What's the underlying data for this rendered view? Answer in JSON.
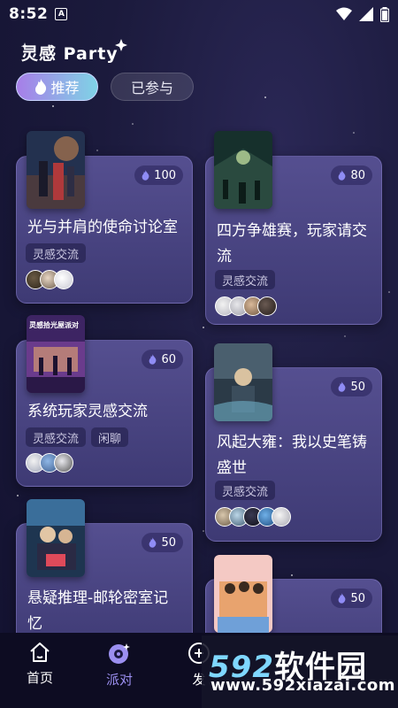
{
  "status_bar": {
    "time": "8:52"
  },
  "header": {
    "title": "灵感 Party"
  },
  "tabs": [
    {
      "label": "推荐",
      "active": true
    },
    {
      "label": "已参与",
      "active": false
    }
  ],
  "cards": [
    {
      "title_lines": [
        "光与并肩的使命讨论室"
      ],
      "heat": "100",
      "tags": [
        "灵感交流"
      ]
    },
    {
      "title_lines": [
        "四方争雄赛，玩家请交",
        "流"
      ],
      "heat": "80",
      "tags": [
        "灵感交流"
      ]
    },
    {
      "title_lines": [
        "系统玩家灵感交流"
      ],
      "heat": "60",
      "tags": [
        "灵感交流",
        "闲聊"
      ],
      "cover_text": "灵感拾光屋派对"
    },
    {
      "title_lines": [
        "风起大雍：我以史笔铸",
        "盛世"
      ],
      "heat": "50",
      "tags": [
        "灵感交流"
      ]
    },
    {
      "title_lines": [
        "悬疑推理-邮轮密室记",
        "忆"
      ],
      "heat": "50",
      "tags": []
    },
    {
      "title_lines": [],
      "heat": "50",
      "tags": []
    }
  ],
  "nav": [
    {
      "label": "首页",
      "icon": "home-icon"
    },
    {
      "label": "派对",
      "icon": "party-icon"
    },
    {
      "label": "发",
      "icon": "publish-icon"
    }
  ],
  "watermark": {
    "brand_digits": "592",
    "brand_cn": "软件园",
    "url": "www.592xiazai.com"
  },
  "colors": {
    "accent": "#9b8ff0",
    "card": "#4a4584",
    "background": "#1b1a3c"
  }
}
